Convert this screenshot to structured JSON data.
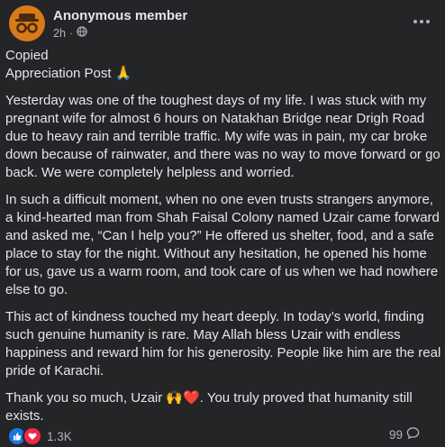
{
  "post": {
    "author": "Anonymous member",
    "time": "2h",
    "paragraphs": [
      "Copied",
      "Appreciation Post 🙏",
      "Yesterday was one of the toughest days of my life. I was stuck with my pregnant wife for almost 6 hours on Natakhan Bridge near Drigh Road due to heavy rain and terrible traffic. My wife was in pain, my car broke down because of rainwater, and there was no way to move forward or go back. We were completely helpless and worried.",
      "In such a difficult moment, when no one even trusts strangers anymore, a kind-hearted man from Shah Faisal Colony named Uzair came forward and asked me, “Can I help you?” He offered us shelter, food, and a safe place to stay for the night. Without any hesitation, he opened his home for us, gave us a warm room, and took care of us when we had nowhere else to go.",
      "This act of kindness touched my heart deeply. In today’s world, finding such genuine humanity is rare. May Allah bless Uzair with endless happiness and reward him for his generosity. People like him are the real pride of Karachi.",
      "Thank you so much, Uzair 🙌❤️. You truly proved that humanity still exists."
    ]
  },
  "footer": {
    "reaction_count": "1.3K",
    "comment_count": "99"
  },
  "icons": {
    "avatar": "anonymous-incognito-icon",
    "audience": "globe-icon",
    "more": "more-options-icon",
    "like": "like-icon",
    "love": "love-icon",
    "comment": "comment-icon"
  },
  "colors": {
    "background": "#242526",
    "text": "#e4e6eb",
    "secondary": "#b0b3b8",
    "avatar": "#d97a1a",
    "like": "#1b74e4",
    "love": "#f02849"
  }
}
